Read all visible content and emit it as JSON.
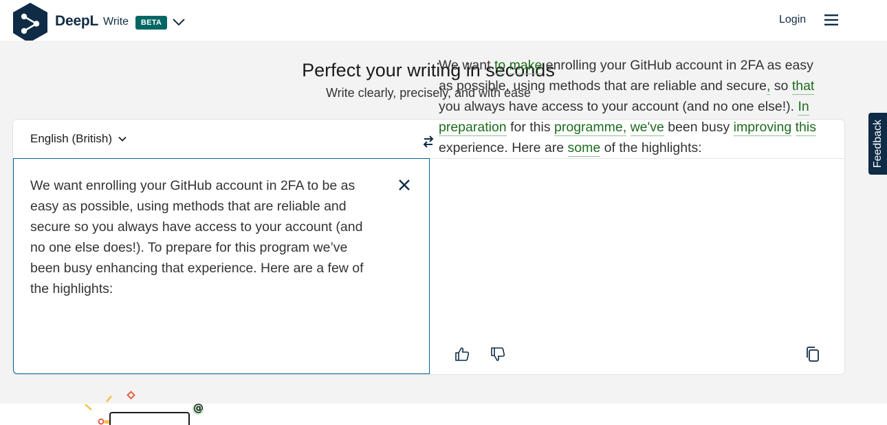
{
  "header": {
    "brand": "DeepL",
    "product": "Write",
    "badge": "BETA",
    "login_label": "Login",
    "icons": {
      "logo": "deepl-logo",
      "product_menu": "chevron-down-icon",
      "menu": "hamburger-menu-icon"
    }
  },
  "hero": {
    "title": "Perfect your writing in seconds",
    "subtitle": "Write clearly, precisely, and with ease"
  },
  "editor": {
    "language": "English (British)",
    "input_text": "We want enrolling your GitHub account in 2FA to be as easy as possible, using methods that are reliable and secure so you always have access to your account (and no one else does!). To prepare for this program we’ve been busy enhancing that experience. Here are a few of the highlights:",
    "output_segments": [
      {
        "t": "We want ",
        "c": false
      },
      {
        "t": "to",
        "c": true
      },
      {
        "t": " ",
        "c": false
      },
      {
        "t": "make",
        "c": true
      },
      {
        "t": " enrolling your GitHub account in 2FA as easy as possible, using methods that are reliable and secure",
        "c": false
      },
      {
        "t": ",",
        "c": true
      },
      {
        "t": " so ",
        "c": false
      },
      {
        "t": "that",
        "c": true
      },
      {
        "t": " you always have access to your account (and no one else!). ",
        "c": false
      },
      {
        "t": "In",
        "c": true
      },
      {
        "t": " ",
        "c": false
      },
      {
        "t": "preparation",
        "c": true
      },
      {
        "t": " for this ",
        "c": false
      },
      {
        "t": "programme,",
        "c": true
      },
      {
        "t": " ",
        "c": false
      },
      {
        "t": "we've",
        "c": true
      },
      {
        "t": " been busy ",
        "c": false
      },
      {
        "t": "improving",
        "c": true
      },
      {
        "t": " ",
        "c": false
      },
      {
        "t": "this",
        "c": true
      },
      {
        "t": " experience. Here are ",
        "c": false
      },
      {
        "t": "some",
        "c": true
      },
      {
        "t": " of the highlights:",
        "c": false
      }
    ],
    "icons": {
      "swap": "swap-arrows-icon",
      "clear": "close-icon",
      "like": "thumbs-up-icon",
      "dislike": "thumbs-down-icon",
      "copy": "copy-icon"
    }
  },
  "feedback_label": "Feedback",
  "colors": {
    "brand_navy": "#0f2b46",
    "beta_teal": "#006765",
    "accent_blue": "#006494",
    "change_green": "#1d6b1d"
  }
}
